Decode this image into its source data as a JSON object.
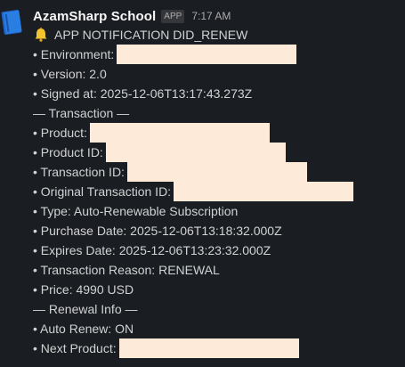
{
  "message": {
    "app_name": "AzamSharp School",
    "app_badge": "APP",
    "time": "7:17 AM",
    "title": "APP NOTIFICATION DID_RENEW",
    "lines": {
      "environment": "• Environment:",
      "version": "• Version: 2.0",
      "signed_at": "• Signed at: 2025-12-06T13:17:43.273Z",
      "transaction_header": "— Transaction —",
      "product": "• Product:",
      "product_id": "• Product ID:",
      "transaction_id": "• Transaction ID:",
      "original_transaction_id": "• Original Transaction ID:",
      "type": "• Type: Auto-Renewable Subscription",
      "purchase_date": "• Purchase Date: 2025-12-06T13:18:32.000Z",
      "expires_date": "• Expires Date: 2025-12-06T13:23:32.000Z",
      "transaction_reason": "• Transaction Reason: RENEWAL",
      "price": "• Price: 4990 USD",
      "renewal_header": "— Renewal Info —",
      "auto_renew": "• Auto Renew: ON",
      "next_product": "• Next Product:"
    }
  },
  "colors": {
    "background": "#1a1d21",
    "text": "#d1d2d3",
    "redaction": "#feead8"
  },
  "icons": {
    "avatar": "book-app-icon",
    "title": "bell-icon"
  }
}
